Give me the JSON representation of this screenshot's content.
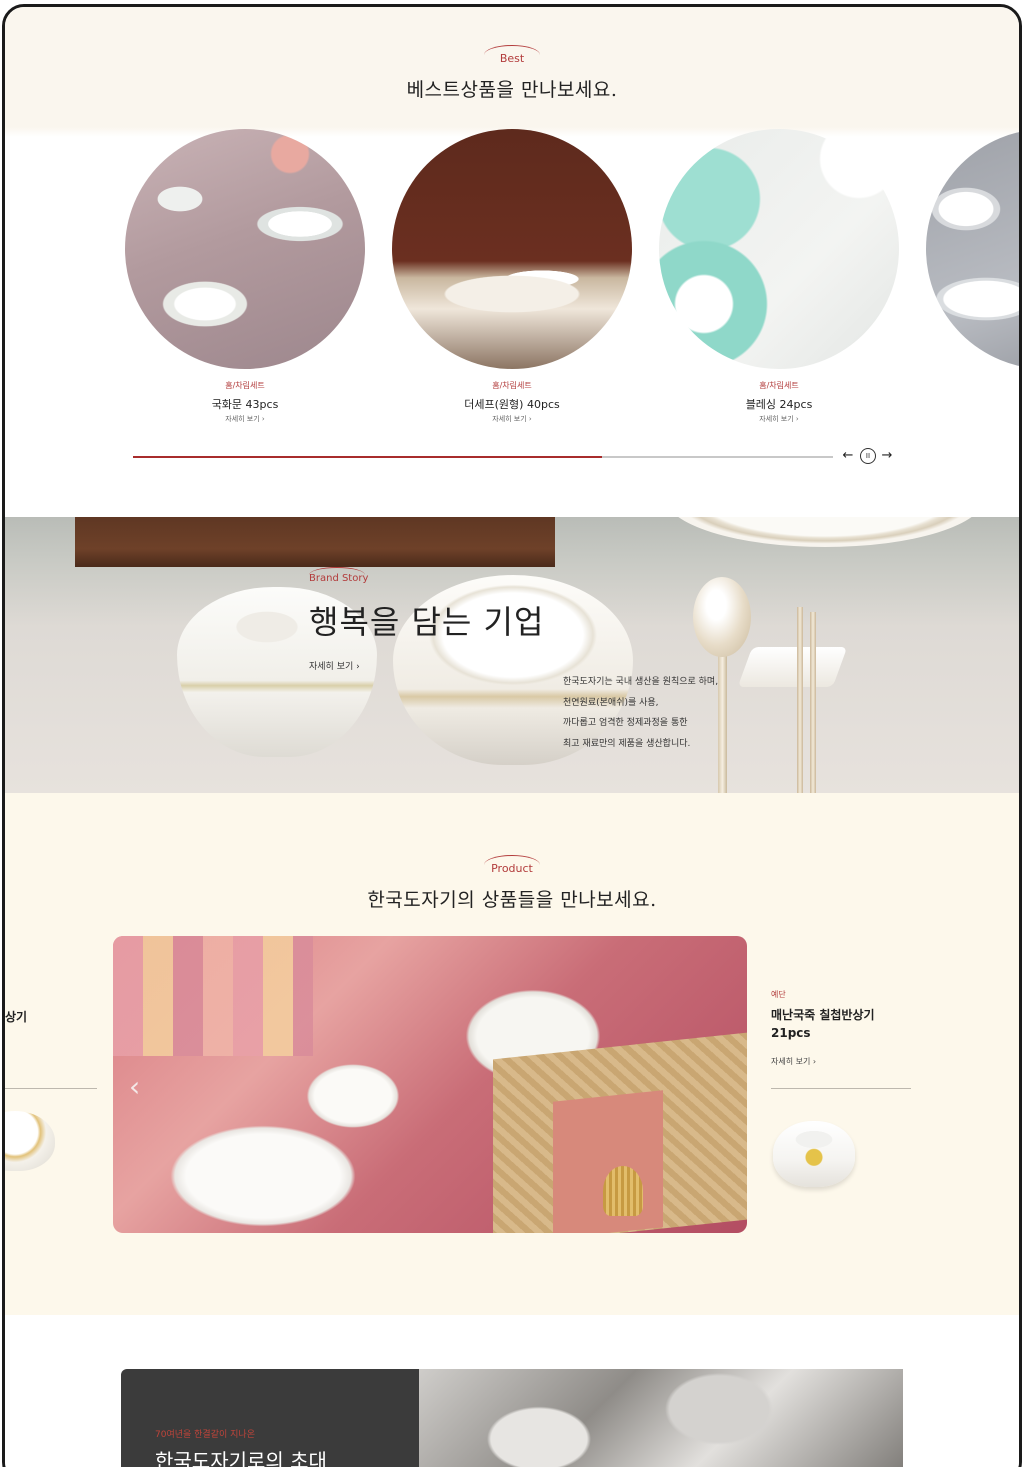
{
  "best": {
    "tag": "Best",
    "title": "베스트상품을 만나보세요.",
    "items": [
      {
        "category": "홈/차림세트",
        "name": "국화문 43pcs",
        "more": "자세히 보기"
      },
      {
        "category": "홈/차림세트",
        "name": "더세프(원형) 40pcs",
        "more": "자세히 보기"
      },
      {
        "category": "홈/차림세트",
        "name": "블레싱 24pcs",
        "more": "자세히 보기"
      }
    ],
    "progress": 0.67,
    "controls": {
      "prev": "←",
      "pause": "II",
      "next": "→"
    }
  },
  "brand": {
    "tag": "Brand Story",
    "title": "행복을 담는 기업",
    "more": "자세히 보기",
    "description": [
      "한국도자기는 국내 생산을 원칙으로 하며,",
      "천연원료(본애쉬)를 사용,",
      "까다롭고 엄격한 정제과정을 통한",
      "최고 재료만의 제품을 생산합니다."
    ]
  },
  "product": {
    "tag": "Product",
    "title": "한국도자기의 상품들을 만나보세요.",
    "prev_name_fragment": "상기",
    "prev_arrow": "‹",
    "next_item": {
      "category": "예단",
      "name_line1": "매난국죽 칠첩반상기",
      "name_line2": "21pcs",
      "more": "자세히 보기"
    }
  },
  "invite": {
    "subtitle": "70여년을 한결같이 지나온",
    "title": "한국도자기로의 초대"
  },
  "colors": {
    "accent": "#b23b3b",
    "cream": "#fdf8eb",
    "dark_panel": "#3b3b3b"
  }
}
